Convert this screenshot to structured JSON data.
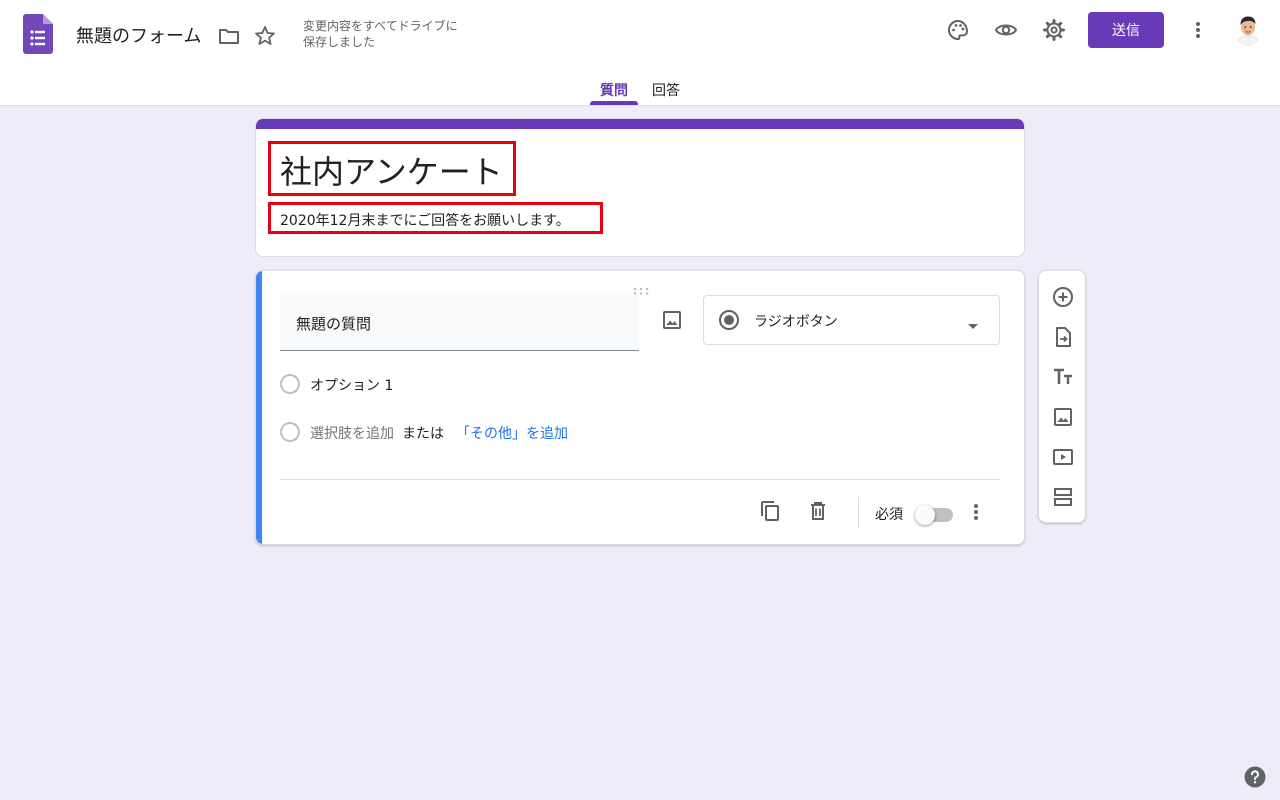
{
  "header": {
    "title": "無題のフォーム",
    "save_status_line1": "変更内容をすべてドライブに",
    "save_status_line2": "保存しました",
    "send_label": "送信"
  },
  "tabs": [
    {
      "label": "質問",
      "active": true
    },
    {
      "label": "回答",
      "active": false
    }
  ],
  "form": {
    "heading": "社内アンケート",
    "description": "2020年12月末までにご回答をお願いします。"
  },
  "question": {
    "title": "無題の質問",
    "type_label": "ラジオボタン",
    "options": [
      "オプション 1"
    ],
    "add_option": "選択肢を追加",
    "or_text": "または",
    "add_other": "「その他」を追加",
    "required_label": "必須",
    "required": false
  },
  "icons": {
    "header": [
      "palette-icon",
      "eye-icon",
      "gear-icon",
      "more-vert-icon"
    ],
    "side_toolbar": [
      "add-question-icon",
      "import-questions-icon",
      "title-text-icon",
      "image-icon",
      "video-icon",
      "section-icon"
    ],
    "footer": [
      "duplicate-icon",
      "delete-icon",
      "more-vert-icon"
    ]
  },
  "colors": {
    "accent": "#673ab7",
    "background": "#f0ebf8",
    "question_bar": "#4285f4",
    "link": "#1a73e8",
    "highlight_box": "#e60012"
  }
}
